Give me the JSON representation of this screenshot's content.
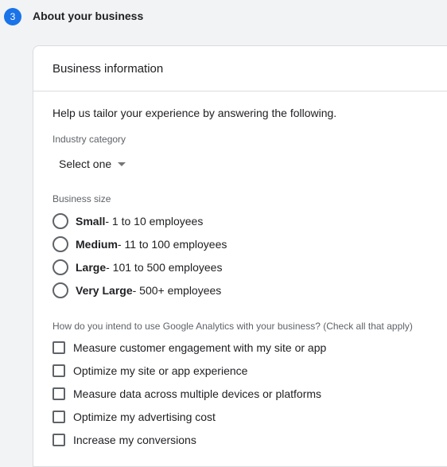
{
  "step": {
    "number": "3",
    "title": "About your business"
  },
  "card": {
    "title": "Business information",
    "intro": "Help us tailor your experience by answering the following."
  },
  "industry": {
    "label": "Industry category",
    "value": "Select one"
  },
  "business_size": {
    "label": "Business size",
    "options": [
      {
        "name": "Small",
        "detail": " - 1 to 10 employees"
      },
      {
        "name": "Medium",
        "detail": " - 11 to 100 employees"
      },
      {
        "name": "Large",
        "detail": " - 101 to 500 employees"
      },
      {
        "name": "Very Large",
        "detail": " - 500+ employees"
      }
    ]
  },
  "usage": {
    "label": "How do you intend to use Google Analytics with your business? (Check all that apply)",
    "options": [
      "Measure customer engagement with my site or app",
      "Optimize my site or app experience",
      "Measure data across multiple devices or platforms",
      "Optimize my advertising cost",
      "Increase my conversions"
    ]
  }
}
